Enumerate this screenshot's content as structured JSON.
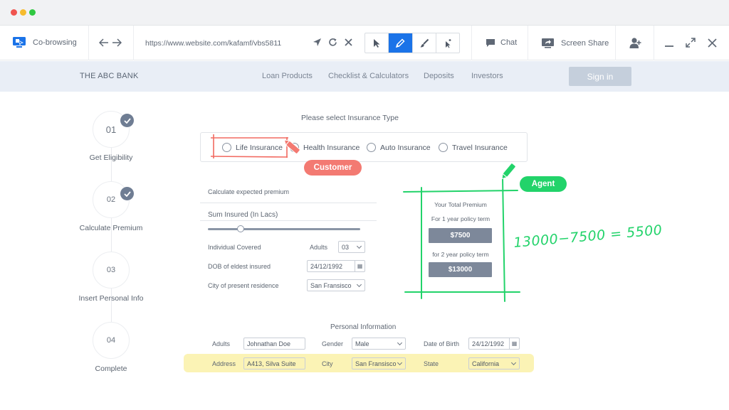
{
  "window": {
    "controls": [
      "close",
      "minimize",
      "maximize"
    ],
    "colors": {
      "close": "#f0544f",
      "minimize": "#f6bb2e",
      "maximize": "#2fc841"
    }
  },
  "toolbar": {
    "cobrowsing_label": "Co-browsing",
    "url": "https://www.website.com/kafamf/vbs5811",
    "chat_label": "Chat",
    "screen_share_label": "Screen Share",
    "tools": [
      "pointer-icon",
      "pen-icon",
      "brush-icon",
      "laser-pointer-icon"
    ],
    "active_tool": "pen-icon",
    "accent_color": "#1b73e8"
  },
  "site": {
    "brand": "THE ABC BANK",
    "nav": [
      "Loan Products",
      "Checklist & Calculators",
      "Deposits",
      "Investors"
    ],
    "signin_label": "Sign in"
  },
  "steps": [
    {
      "number": "01",
      "label": "Get Eligibility",
      "done": true
    },
    {
      "number": "02",
      "label": "Calculate Premium",
      "done": true
    },
    {
      "number": "03",
      "label": "Insert Personal Info",
      "done": false
    },
    {
      "number": "04",
      "label": "Complete",
      "done": false
    }
  ],
  "insurance": {
    "title": "Please select Insurance Type",
    "options": [
      "Life Insurance",
      "Health Insurance",
      "Auto Insurance",
      "Travel Insurance"
    ]
  },
  "premium_form": {
    "title": "Calculate expected premium",
    "sum_insured_label": "Sum Insured (In Lacs)",
    "sum_insured_slider_fraction": 0.2,
    "individual_covered_label": "Individual Covered",
    "adults_label": "Adults",
    "adults_value": "03",
    "dob_label": "DOB of eldest insured",
    "dob_value": "24/12/1992",
    "city_label": "City of present residence",
    "city_value": "San Fransisco"
  },
  "premium_result": {
    "title": "Your Total Premium",
    "term1_label": "For 1 year policy term",
    "term1_value": "$7500",
    "term2_label": "for 2 year policy term",
    "term2_value": "$13000"
  },
  "personal_info": {
    "title": "Personal Information",
    "row1": {
      "adults_label": "Adults",
      "adults_value": "Johnathan Doe",
      "gender_label": "Gender",
      "gender_value": "Male",
      "dob_label": "Date of Birth",
      "dob_value": "24/12/1992"
    },
    "row2": {
      "address_label": "Address",
      "address_value": "A413, Silva Suite",
      "city_label": "City",
      "city_value": "San Fransisco",
      "state_label": "State",
      "state_value": "California"
    }
  },
  "annotations": {
    "customer_label": "Customer",
    "customer_color": "#f37a72",
    "agent_label": "Agent",
    "agent_color": "#22d36a",
    "handwritten_note": "13000−7500 = 5500"
  }
}
